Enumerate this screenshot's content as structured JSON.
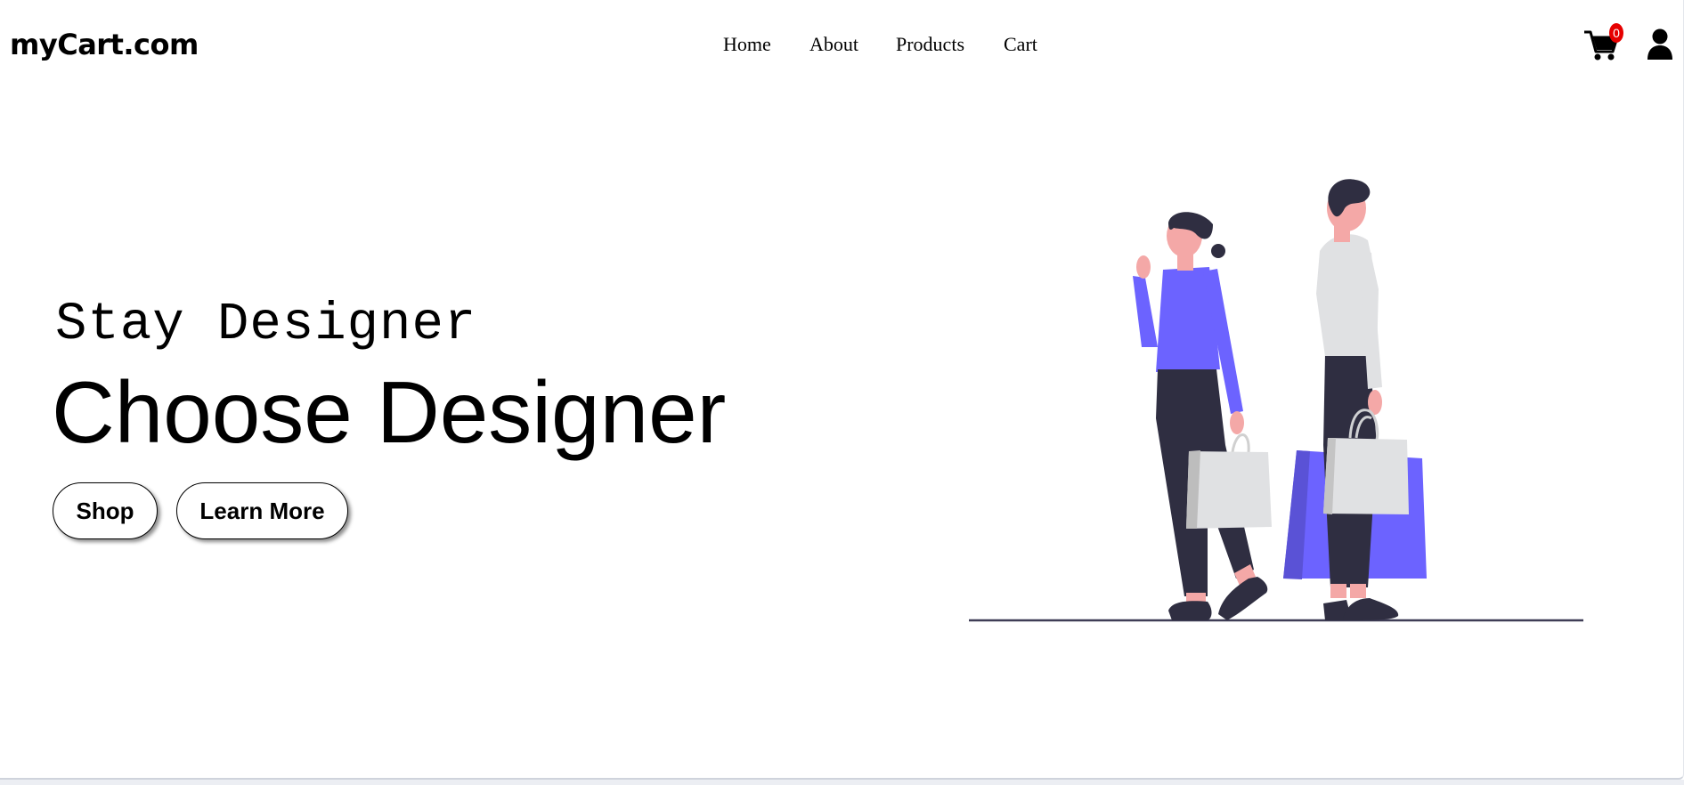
{
  "header": {
    "brand": "myCart.com",
    "nav": [
      "Home",
      "About",
      "Products",
      "Cart"
    ],
    "cart_count": "0",
    "icons": {
      "cart": "shopping-cart-icon",
      "user": "user-icon"
    }
  },
  "hero": {
    "subtitle": "Stay Designer",
    "title": "Choose Designer",
    "buttons": {
      "shop": "Shop",
      "learn_more": "Learn More"
    }
  },
  "colors": {
    "accent_purple": "#6c63ff",
    "dark": "#2f2e41",
    "skin": "#f4a8a7",
    "light_gray": "#e0e1e3",
    "badge_red": "#e60000"
  }
}
